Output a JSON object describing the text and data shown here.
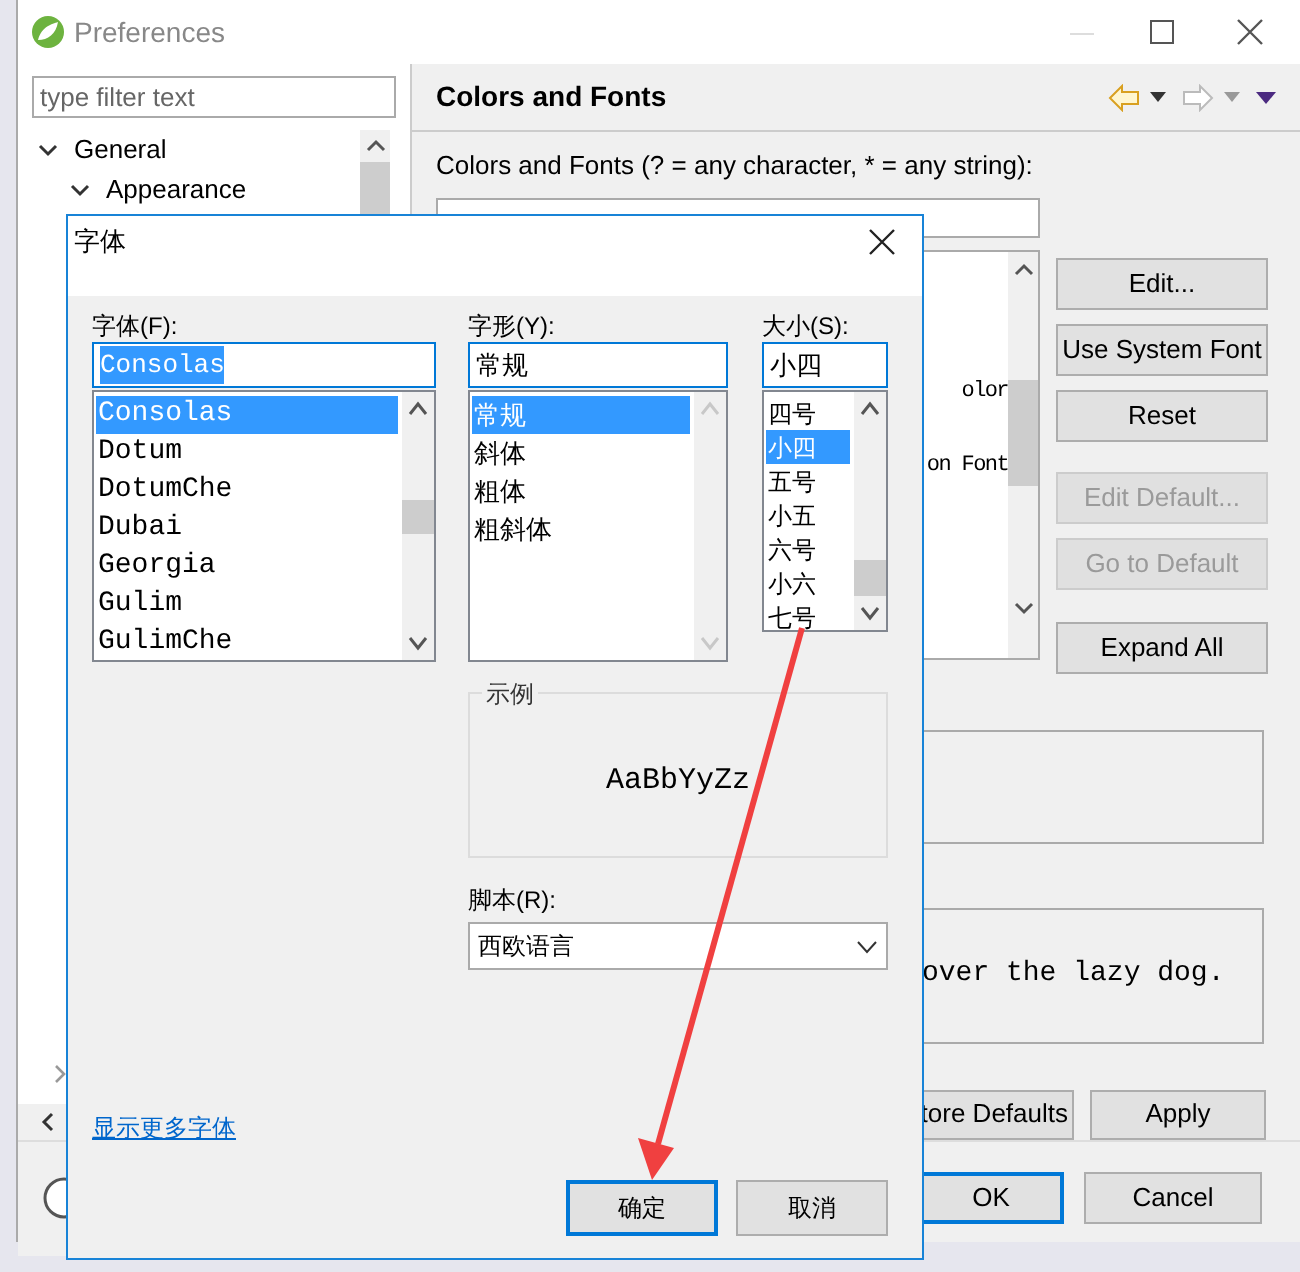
{
  "window": {
    "title": "Preferences"
  },
  "sidebar": {
    "filter": {
      "placeholder": "type filter text"
    },
    "tree": [
      {
        "label": "General",
        "expanded": true,
        "children": [
          {
            "label": "Appearance",
            "expanded": true
          }
        ]
      }
    ]
  },
  "page": {
    "title": "Colors and Fonts",
    "filter_label": "Colors and Fonts (? = any character, * = any string):",
    "tree_fragments": [
      "olor",
      "on Font"
    ],
    "buttons": [
      {
        "label": "Edit...",
        "disabled": false
      },
      {
        "label": "Use System Font",
        "disabled": false
      },
      {
        "label": "Reset",
        "disabled": false
      },
      {
        "label": "Edit Default...",
        "disabled": true
      },
      {
        "label": "Go to Default",
        "disabled": true
      },
      {
        "label": "Expand All",
        "disabled": false
      }
    ],
    "preview_text": "over the lazy dog.",
    "actions": [
      {
        "label": "tore Defaults"
      },
      {
        "label": "Apply"
      }
    ]
  },
  "footer_buttons": [
    {
      "label": "OK",
      "default": true
    },
    {
      "label": "Cancel",
      "default": false
    }
  ],
  "font_dialog": {
    "title": "字体",
    "font": {
      "label": "字体(F):",
      "value": "Consolas",
      "items": [
        {
          "label": "Consolas",
          "selected": true
        },
        {
          "label": "Dotum",
          "selected": false
        },
        {
          "label": "DotumChe",
          "selected": false
        },
        {
          "label": "Dubai",
          "selected": false
        },
        {
          "label": "Georgia",
          "selected": false
        },
        {
          "label": "Gulim",
          "selected": false
        },
        {
          "label": "GulimChe",
          "selected": false
        }
      ]
    },
    "style": {
      "label": "字形(Y):",
      "value": "常规",
      "items": [
        {
          "label": "常规",
          "selected": true
        },
        {
          "label": "斜体",
          "selected": false
        },
        {
          "label": "粗体",
          "selected": false
        },
        {
          "label": "粗斜体",
          "selected": false
        }
      ]
    },
    "size": {
      "label": "大小(S):",
      "value": "小四",
      "items": [
        {
          "label": "四号",
          "selected": false
        },
        {
          "label": "小四",
          "selected": true
        },
        {
          "label": "五号",
          "selected": false
        },
        {
          "label": "小五",
          "selected": false
        },
        {
          "label": "六号",
          "selected": false
        },
        {
          "label": "小六",
          "selected": false
        },
        {
          "label": "七号",
          "selected": false
        }
      ]
    },
    "sample": {
      "label": "示例",
      "text": "AaBbYyZz"
    },
    "script": {
      "label": "脚本(R):",
      "value": "西欧语言"
    },
    "more_fonts_link": "显示更多字体",
    "buttons": [
      {
        "label": "确定",
        "default": true
      },
      {
        "label": "取消",
        "default": false
      }
    ]
  }
}
